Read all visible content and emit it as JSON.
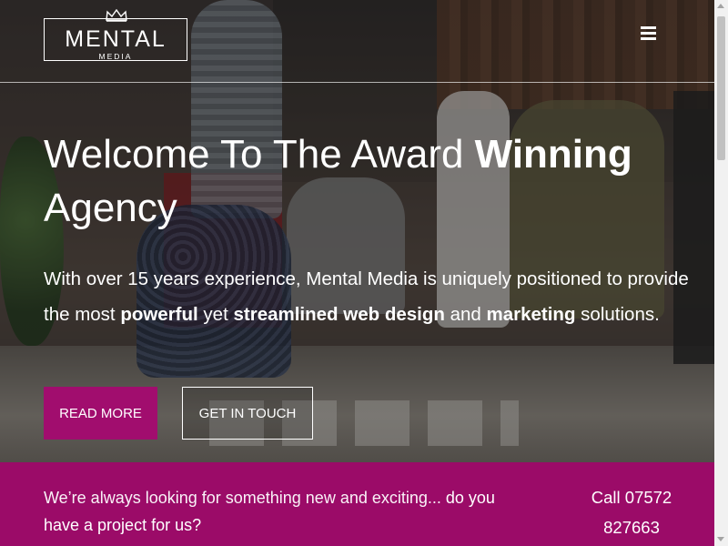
{
  "header": {
    "logo_text": "MENTAL",
    "logo_subtext": "MEDIA",
    "menu_icon": "hamburger-menu-icon"
  },
  "hero": {
    "headline_part1": "Welcome To The Award ",
    "headline_bold": "Winning",
    "headline_part2": " Agency",
    "intro_part1": "With over 15 years experience, Mental Media is uniquely positioned to provide the most ",
    "intro_bold1": "powerful",
    "intro_part2": " yet ",
    "intro_bold2": "streamlined web design",
    "intro_part3": " and ",
    "intro_bold3": "marketing",
    "intro_part4": " solutions.",
    "button_read_more": "READ MORE",
    "button_get_in_touch": "GET IN TOUCH"
  },
  "cta": {
    "text_light": "We’re always looking for something new and exciting... ",
    "text_strong": "do you have a project for us?",
    "call_label": "Call 07572 827663"
  },
  "colors": {
    "accent": "#a10d6e",
    "band": "#9b0b68"
  }
}
